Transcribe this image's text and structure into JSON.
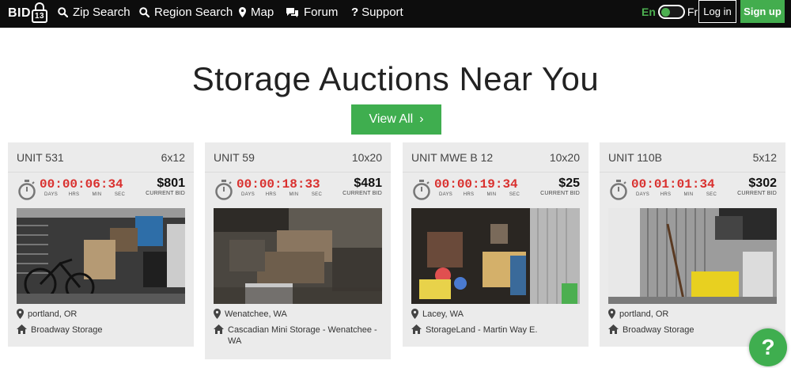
{
  "nav": {
    "logo_text": "BID",
    "logo_num": "13",
    "items": [
      {
        "label": "Zip Search",
        "icon": "search-icon"
      },
      {
        "label": "Region Search",
        "icon": "search-icon"
      },
      {
        "label": "Map",
        "icon": "map-marker-icon"
      },
      {
        "label": "Forum",
        "icon": "chat-bubbles-icon"
      },
      {
        "label": "Support",
        "icon": "question-icon"
      }
    ],
    "lang_en": "En",
    "lang_fr": "Fr",
    "login": "Log in",
    "signup": "Sign up"
  },
  "hero": {
    "title": "Storage Auctions Near You",
    "view_all": "View All",
    "view_all_chevron": "›"
  },
  "units_labels": {
    "days": "DAYS",
    "hrs": "HRS",
    "min": "MIN",
    "sec": "SEC",
    "current_bid": "CURRENT BID"
  },
  "cards": [
    {
      "unit": "UNIT 531",
      "size": "6x12",
      "days": "00",
      "hrs": "00",
      "min": "06",
      "sec": "34",
      "bid": "$801",
      "city": "portland, OR",
      "facility": "Broadway Storage"
    },
    {
      "unit": "UNIT 59",
      "size": "10x20",
      "days": "00",
      "hrs": "00",
      "min": "18",
      "sec": "33",
      "bid": "$481",
      "city": "Wenatchee, WA",
      "facility": "Cascadian Mini Storage - Wenatchee - WA"
    },
    {
      "unit": "UNIT MWE B 12",
      "size": "10x20",
      "days": "00",
      "hrs": "00",
      "min": "19",
      "sec": "34",
      "bid": "$25",
      "city": "Lacey, WA",
      "facility": "StorageLand - Martin Way E."
    },
    {
      "unit": "UNIT 110B",
      "size": "5x12",
      "days": "00",
      "hrs": "01",
      "min": "01",
      "sec": "34",
      "bid": "$302",
      "city": "portland, OR",
      "facility": "Broadway Storage"
    }
  ],
  "help": {
    "label": "?"
  },
  "colors": {
    "accent": "#3fae4f",
    "timer": "#d9302e",
    "card_bg": "#ebebeb",
    "nav_bg": "#0d0d0d"
  }
}
